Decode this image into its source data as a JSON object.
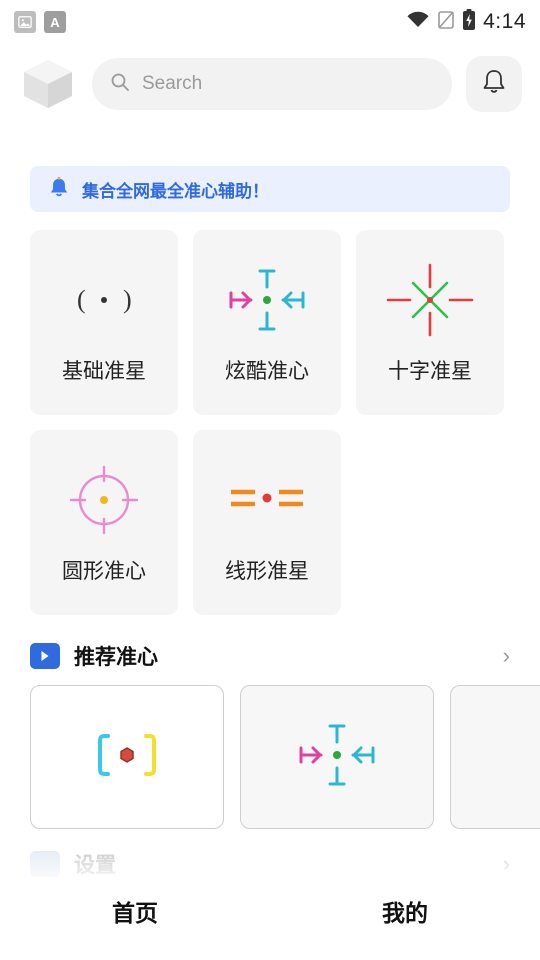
{
  "status_bar": {
    "icons": [
      "image-icon",
      "font-icon"
    ],
    "right_icons": [
      "wifi-icon",
      "sim-off-icon",
      "battery-icon"
    ],
    "time": "4:14"
  },
  "header": {
    "logo": "cube-logo",
    "search": {
      "placeholder": "Search",
      "value": "",
      "icon": "search-icon"
    },
    "notification_icon": "bell-icon"
  },
  "banner": {
    "icon": "bell-blue-icon",
    "text": "集合全网最全准心辅助！"
  },
  "cards": [
    {
      "label": "基础准星",
      "art": "dot-parens"
    },
    {
      "label": "炫酷准心",
      "art": "cross-arrows"
    },
    {
      "label": "十字准星",
      "art": "star-burst"
    },
    {
      "label": "圆形准心",
      "art": "circle-ring"
    },
    {
      "label": "线形准星",
      "art": "lines-dot"
    }
  ],
  "recommend": {
    "title": "推荐准心",
    "icon": "screen-plus-icon",
    "more_icon": "chevron-right-icon",
    "items": [
      {
        "art": "brackets-hex"
      },
      {
        "art": "cross-arrows"
      },
      {
        "art": "blank"
      }
    ]
  },
  "settings_section": {
    "title": "设置",
    "icon": "settings-icon",
    "more_icon": "chevron-right-icon",
    "items": [
      "",
      "",
      ""
    ]
  },
  "tabbar": {
    "items": [
      {
        "label": "首页",
        "active": true
      },
      {
        "label": "我的",
        "active": false
      }
    ]
  },
  "colors": {
    "accent": "#2f6bdf",
    "banner_bg": "#eaf0fe",
    "card_bg": "#f5f5f5",
    "muted_text": "#9a9a9a"
  }
}
